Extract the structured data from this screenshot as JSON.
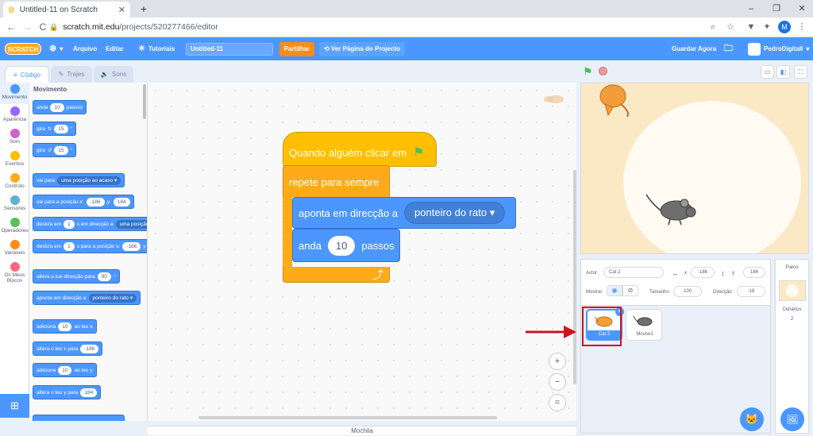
{
  "browser": {
    "tab_title": "Untitled-11 on Scratch",
    "tab_close": "✕",
    "new_tab": "+",
    "minimize": "–",
    "restore": "❐",
    "close": "✕",
    "back": "←",
    "forward": "→",
    "reload": "C",
    "url_host": "scratch.mit.edu",
    "url_path": "/projects/520277466/editor",
    "profile_initial": "M"
  },
  "menubar": {
    "logo": "SCRATCH",
    "file": "Arquivo",
    "edit": "Editar",
    "tutorials": "Tutoriais",
    "project_title": "Untitled-11",
    "share": "Partilhar",
    "see_project": "Ver Página do Projecto",
    "save_now": "Guardar Agora",
    "username": "PedroDigitall"
  },
  "editor_tabs": {
    "code": "Código",
    "costumes": "Trajes",
    "sounds": "Sons"
  },
  "categories": [
    {
      "label": "Movimento",
      "color": "#4c97ff"
    },
    {
      "label": "Aparência",
      "color": "#9966ff"
    },
    {
      "label": "Som",
      "color": "#cf63cf"
    },
    {
      "label": "Eventos",
      "color": "#ffbf00"
    },
    {
      "label": "Controlo",
      "color": "#ffab19"
    },
    {
      "label": "Sensores",
      "color": "#5cb1d6"
    },
    {
      "label": "Operadores",
      "color": "#59c059"
    },
    {
      "label": "Variáveis",
      "color": "#ff8c1a"
    },
    {
      "label": "Os Meus Blocos",
      "color": "#ff6680"
    }
  ],
  "palette": {
    "title": "Movimento",
    "b1": {
      "a": "anda",
      "v": "10",
      "b": "passos"
    },
    "b2": {
      "a": "gira",
      "icon": "↻",
      "v": "15",
      "b": "°"
    },
    "b3": {
      "a": "gira",
      "icon": "↺",
      "v": "15",
      "b": "°"
    },
    "b4": {
      "a": "vai para",
      "dd": "uma posição ao acaso ▾"
    },
    "b5": {
      "a": "vai para a posição x:",
      "x": "-186",
      "b": "y:",
      "y": "184"
    },
    "b6": {
      "a": "desliza em",
      "v": "1",
      "b": "s em direcção a",
      "dd": "uma posição"
    },
    "b7": {
      "a": "desliza em",
      "v": "1",
      "b": "s para a posição x:",
      "x": "-186",
      "c": "y"
    },
    "b8": {
      "a": "altera a tua direcção para",
      "v": "90",
      "b": "°"
    },
    "b9": {
      "a": "aponta em direcção a",
      "dd": "ponteiro do rato ▾"
    },
    "b10": {
      "a": "adiciona",
      "v": "10",
      "b": "ao teu x"
    },
    "b11": {
      "a": "altera o teu x para",
      "v": "-186"
    },
    "b12": {
      "a": "adiciona",
      "v": "10",
      "b": "ao teu y"
    },
    "b13": {
      "a": "altera o teu y para",
      "v": "184"
    }
  },
  "script": {
    "hat": "Quando alguém clicar em",
    "forever": "repete para sempre",
    "point": "aponta em direcção a",
    "point_target": "ponteiro do rato ▾",
    "move_a": "anda",
    "move_v": "10",
    "move_b": "passos",
    "loop_arrow": "⤴"
  },
  "zoom": {
    "in": "+",
    "out": "−",
    "reset": "="
  },
  "backpack": "Mochila",
  "sprite_info": {
    "actor_label": "Actor",
    "actor_name": "Cat 2",
    "x_label": "x",
    "x": "-186",
    "y_label": "y",
    "y": "184",
    "show_label": "Mostrar",
    "size_label": "Tamanho",
    "size": "100",
    "direction_label": "Direcção",
    "direction": "-18"
  },
  "sprites": [
    {
      "name": "Cat 2",
      "selected": true
    },
    {
      "name": "Mouse1",
      "selected": false
    }
  ],
  "stage_pane": {
    "title": "Palco",
    "backdrops_label": "Cenários",
    "backdrops_count": "2"
  },
  "colors": {
    "accent": "#4c97ff",
    "events": "#ffbf00",
    "control": "#ffab19",
    "share": "#ff8c1a",
    "annotation_red": "#d0121b"
  }
}
